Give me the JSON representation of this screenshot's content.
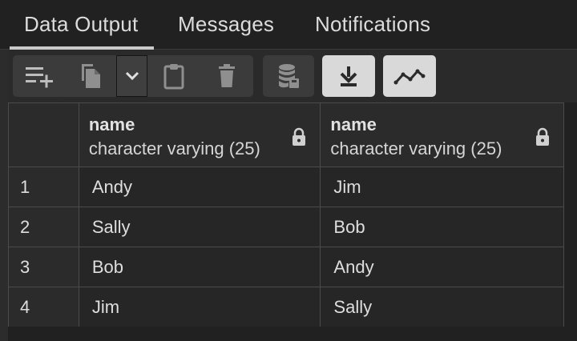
{
  "tabs": [
    {
      "label": "Data Output",
      "active": true
    },
    {
      "label": "Messages",
      "active": false
    },
    {
      "label": "Notifications",
      "active": false
    }
  ],
  "toolbar": {
    "buttons": [
      {
        "icon": "add-row-icon"
      },
      {
        "icon": "copy-icon"
      },
      {
        "icon": "chevron-down-icon"
      },
      {
        "icon": "paste-icon"
      },
      {
        "icon": "delete-icon"
      },
      {
        "icon": "save-data-icon"
      },
      {
        "icon": "download-icon"
      },
      {
        "icon": "graph-visualiser-icon"
      }
    ]
  },
  "table": {
    "columns": [
      {
        "name": "name",
        "type": "character varying (25)"
      },
      {
        "name": "name",
        "type": "character varying (25)"
      }
    ],
    "rows": [
      {
        "num": "1",
        "cells": [
          "Andy",
          "Jim"
        ]
      },
      {
        "num": "2",
        "cells": [
          "Sally",
          "Bob"
        ]
      },
      {
        "num": "3",
        "cells": [
          "Bob",
          "Andy"
        ]
      },
      {
        "num": "4",
        "cells": [
          "Jim",
          "Sally"
        ]
      }
    ]
  },
  "colors": {
    "background": "#212121",
    "toolbar": "#2a2a2a",
    "button": "#3b3b3b",
    "button_active": "#d9d9d9",
    "border": "#4b4b4b"
  }
}
